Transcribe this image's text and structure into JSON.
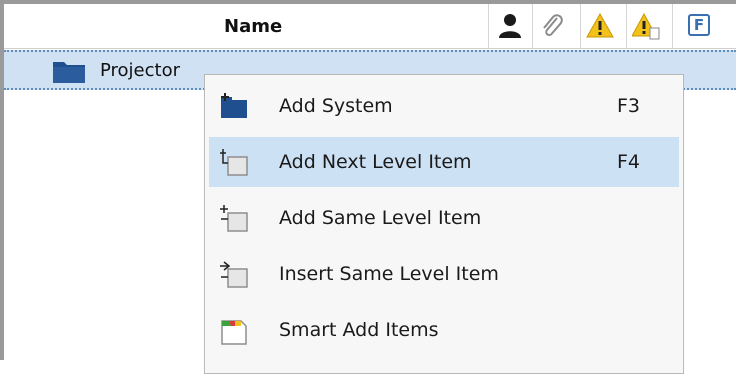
{
  "header": {
    "name_label": "Name",
    "f_label": "F",
    "icons": [
      "user-icon",
      "paperclip-icon",
      "warning-icon",
      "warning-document-icon"
    ]
  },
  "tree": {
    "selected_item": {
      "label": "Projector",
      "icon": "folder-icon"
    }
  },
  "context_menu": {
    "items": [
      {
        "label": "Add System",
        "shortcut": "F3",
        "icon": "add-system-icon"
      },
      {
        "label": "Add Next Level Item",
        "shortcut": "F4",
        "icon": "add-next-level-icon",
        "highlighted": true
      },
      {
        "label": "Add Same Level Item",
        "shortcut": "",
        "icon": "add-same-level-icon"
      },
      {
        "label": "Insert Same Level Item",
        "shortcut": "",
        "icon": "insert-same-level-icon"
      },
      {
        "label": "Smart Add Items",
        "shortcut": "",
        "icon": "smart-add-icon"
      }
    ]
  },
  "colors": {
    "selection": "#cfe1f3",
    "menu_highlight": "#cde1f5",
    "accent_blue": "#3a6fb0",
    "warning_yellow": "#f2c21b"
  }
}
